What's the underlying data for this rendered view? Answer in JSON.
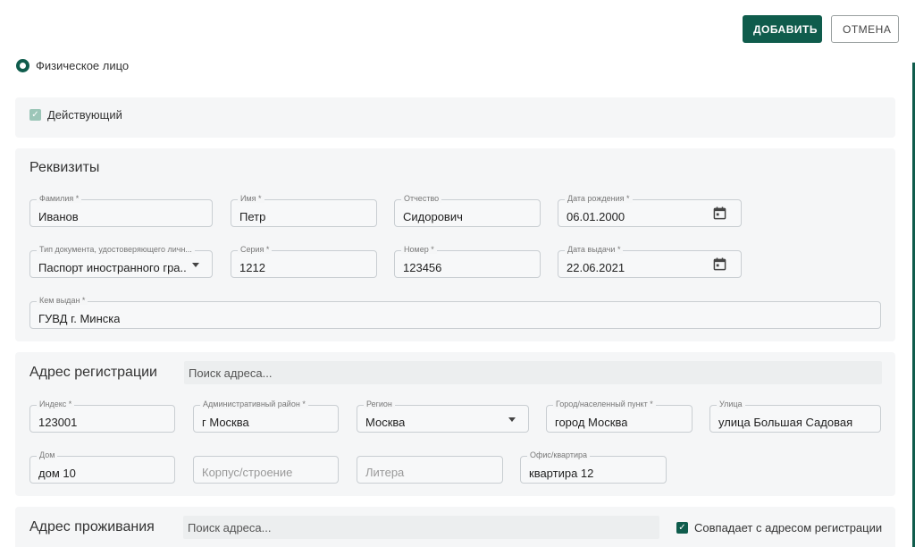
{
  "header": {
    "add_label": "ДОБАВИТЬ",
    "cancel_label": "ОТМЕНА"
  },
  "person_type": {
    "label": "Физическое лицо",
    "selected": true
  },
  "active": {
    "label": "Действующий",
    "checked": true,
    "disabled": true
  },
  "requisites": {
    "title": "Реквизиты",
    "surname": {
      "label": "Фамилия *",
      "value": "Иванов"
    },
    "name": {
      "label": "Имя *",
      "value": "Петр"
    },
    "patronymic": {
      "label": "Отчество",
      "value": "Сидорович"
    },
    "birth_date": {
      "label": "Дата рождения *",
      "value": "06.01.2000"
    },
    "doc_type": {
      "label": "Тип документа, удостоверяющего личн...",
      "value": "Паспорт иностранного гра..."
    },
    "series": {
      "label": "Серия *",
      "value": "1212"
    },
    "number": {
      "label": "Номер *",
      "value": "123456"
    },
    "issue_date": {
      "label": "Дата выдачи *",
      "value": "22.06.2021"
    },
    "issued_by": {
      "label": "Кем выдан *",
      "value": "ГУВД г. Минска"
    }
  },
  "registration_address": {
    "title": "Адрес регистрации",
    "search_placeholder": "Поиск адреса...",
    "index": {
      "label": "Индекс *",
      "value": "123001"
    },
    "district": {
      "label": "Административный район *",
      "value": "г Москва"
    },
    "region": {
      "label": "Регион",
      "value": "Москва"
    },
    "city": {
      "label": "Город/населенный пункт *",
      "value": "город Москва"
    },
    "street": {
      "label": "Улица",
      "value": "улица Большая Садовая"
    },
    "house": {
      "label": "Дом",
      "value": "дом 10"
    },
    "building": {
      "placeholder": "Корпус/строение"
    },
    "letter": {
      "placeholder": "Литера"
    },
    "office": {
      "label": "Офис/квартира",
      "value": "квартира 12"
    }
  },
  "residence_address": {
    "title": "Адрес проживания",
    "search_placeholder": "Поиск адреса...",
    "same_as_registration": {
      "label": "Совпадает с адресом регистрации",
      "checked": true
    }
  },
  "colors": {
    "primary": "#0f5c4c",
    "panel": "#f5f6f7"
  }
}
